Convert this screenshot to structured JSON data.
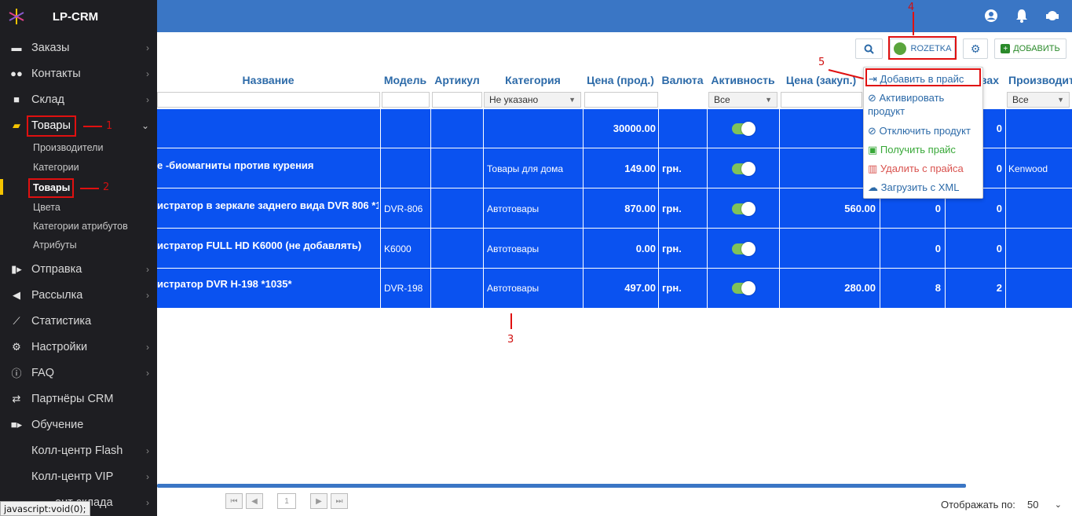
{
  "app": {
    "title": "LP-CRM"
  },
  "sidebar": {
    "items": [
      {
        "label": "Заказы"
      },
      {
        "label": "Контакты"
      },
      {
        "label": "Склад"
      },
      {
        "label": "Товары"
      },
      {
        "label": "Отправка"
      },
      {
        "label": "Рассылка"
      },
      {
        "label": "Статистика"
      },
      {
        "label": "Настройки"
      },
      {
        "label": "FAQ"
      },
      {
        "label": "Партнёры CRM"
      },
      {
        "label": "Обучение"
      },
      {
        "label": "Колл-центр Flash"
      },
      {
        "label": "Колл-центр VIP"
      },
      {
        "label": "ент склада"
      }
    ],
    "sub_items": [
      "Производители",
      "Категории",
      "Товары",
      "Цвета",
      "Категории атрибутов",
      "Атрибуты"
    ]
  },
  "status_tip": "javascript:void(0);",
  "toolbar": {
    "rozetka_label": "ROZETKA",
    "add_label": "ДОБАВИТЬ"
  },
  "table": {
    "headers": [
      "Название",
      "Модель",
      "Артикул",
      "Категория",
      "Цена (прод.)",
      "Валюта",
      "Активность",
      "Цена (закуп.)",
      "вах",
      "Производит"
    ],
    "filters": {
      "category": "Не указано",
      "activity": "Все",
      "manufacturer": "Все"
    },
    "rows": [
      {
        "name": "",
        "model": "",
        "category": "",
        "price": "30000.00",
        "currency": "",
        "purchase": "",
        "c1": "",
        "c2": "0",
        "manufacturer": ""
      },
      {
        "name": "е -биомагниты против курения",
        "model": "",
        "category": "Товары для дома",
        "price": "149.00",
        "currency": "грн.",
        "purchase": "",
        "c1": "",
        "c2": "0",
        "manufacturer": "Kenwood"
      },
      {
        "name": "истратор в зеркале заднего вида DVR 806 *1037*",
        "model": "DVR-806",
        "category": "Автотовары",
        "price": "870.00",
        "currency": "грн.",
        "purchase": "560.00",
        "c1": "0",
        "c2": "0",
        "manufacturer": ""
      },
      {
        "name": "истратор FULL HD K6000 (не добавлять)",
        "model": "K6000",
        "category": "Автотовары",
        "price": "0.00",
        "currency": "грн.",
        "purchase": "",
        "c1": "0",
        "c2": "0",
        "manufacturer": ""
      },
      {
        "name": "истратор DVR H-198 *1035*",
        "model": "DVR-198",
        "category": "Автотовары",
        "price": "497.00",
        "currency": "грн.",
        "purchase": "280.00",
        "c1": "8",
        "c2": "2",
        "manufacturer": ""
      }
    ]
  },
  "dropdown": {
    "items": [
      "Добавить в прайс",
      "Активировать продукт",
      "Отключить продукт",
      "Получить прайс",
      "Удалить с прайса",
      "Загрузить с XML"
    ]
  },
  "pager": {
    "page": "1",
    "per_page_label": "Отображать по:",
    "per_page": "50"
  },
  "annotations": [
    "1",
    "2",
    "3",
    "4",
    "5"
  ]
}
